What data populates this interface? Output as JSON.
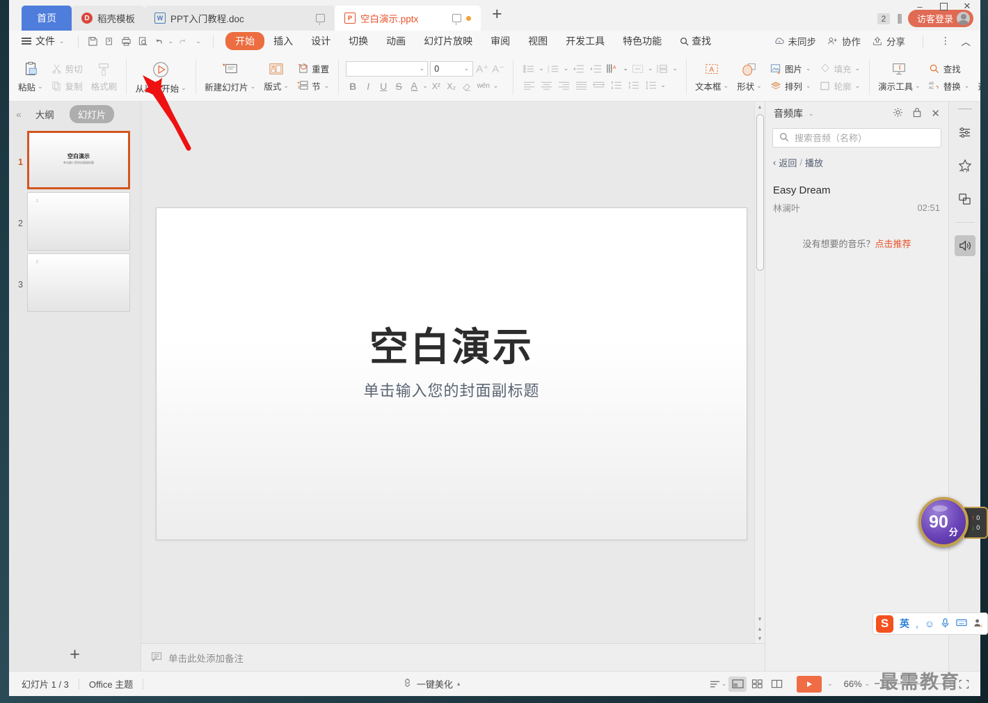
{
  "window": {
    "minimize": "–",
    "maximize": "▢",
    "close": "✕"
  },
  "tabs": {
    "home_label": "首页",
    "items": [
      {
        "name": "稻壳模板",
        "icon": "dockee-icon",
        "type": "plain"
      },
      {
        "name": "PPT入门教程.doc",
        "icon": "word-icon",
        "type": "doc"
      },
      {
        "name": "空白演示.pptx",
        "icon": "ppt-icon",
        "type": "active"
      }
    ],
    "new_tab": "+",
    "count_badge": "2",
    "login_label": "访客登录"
  },
  "menu": {
    "file_label": "文件",
    "quick_icons": [
      "save-icon",
      "print-preview-icon",
      "print-icon",
      "find-doc-icon",
      "undo-icon",
      "redo-icon",
      "customize-icon"
    ],
    "tabs": [
      "开始",
      "插入",
      "设计",
      "切换",
      "动画",
      "幻灯片放映",
      "审阅",
      "视图",
      "开发工具",
      "特色功能",
      "查找"
    ],
    "selected_tab": "开始",
    "right_items": [
      {
        "label": "未同步",
        "icon": "cloud-sync-icon"
      },
      {
        "label": "协作",
        "icon": "collaborate-icon"
      },
      {
        "label": "分享",
        "icon": "share-icon"
      }
    ],
    "more_icon": "more-vertical-icon",
    "collapse_icon": "chevron-up-icon"
  },
  "ribbon": {
    "clipboard": {
      "paste": "粘贴",
      "cut": "剪切",
      "copy": "复制",
      "format_painter": "格式刷"
    },
    "slideshow": {
      "from_current": "从当前开始"
    },
    "slides": {
      "new_slide": "新建幻灯片",
      "layout": "版式",
      "reset": "重置",
      "section": "节"
    },
    "font": {
      "family_value": "",
      "size_value": "0",
      "grow": "A⁺",
      "shrink": "A⁻",
      "bold": "B",
      "italic": "I",
      "underline": "U",
      "strike": "S",
      "font_color": "A",
      "superscript": "X²",
      "subscript": "X₂",
      "clear_format": "clear-format-icon",
      "phonetic": "wén"
    },
    "text_group": {
      "textbox": "文本框",
      "shape": "形状",
      "picture": "图片",
      "arrange": "排列",
      "fill": "填充",
      "outline": "轮廓"
    },
    "tools_group": {
      "present_tools": "演示工具",
      "find": "查找",
      "replace": "替换",
      "select": "选择"
    }
  },
  "slide_panel": {
    "collapse_icon": "double-chevron-left-icon",
    "tab_outline": "大纲",
    "tab_slides": "幻灯片",
    "selected_tab": "幻灯片",
    "slides": [
      {
        "num": "1",
        "title": "空白演示",
        "sub": "单击输入您的封面副标题",
        "selected": true
      },
      {
        "num": "2",
        "placeholder": "1",
        "selected": false
      },
      {
        "num": "3",
        "placeholder": "2",
        "selected": false
      }
    ],
    "add_slide": "+"
  },
  "canvas": {
    "title": "空白演示",
    "subtitle": "单击输入您的封面副标题"
  },
  "notes": {
    "placeholder": "单击此处添加备注",
    "icon": "notes-icon"
  },
  "task_pane": {
    "title": "音频库",
    "settings_icon": "gear-icon",
    "lock_icon": "lock-icon",
    "close_icon": "close-icon",
    "search_placeholder": "搜索音频（名称）",
    "search_value": "",
    "breadcrumb_back": "返回",
    "breadcrumb_sep": "/",
    "breadcrumb_current": "播放",
    "track_name": "Easy Dream",
    "track_artist": "林澜叶",
    "track_duration": "02:51",
    "footer_text": "没有想要的音乐？",
    "footer_link": "点击推荐"
  },
  "rail": {
    "items": [
      {
        "icon": "properties-icon",
        "selected": false
      },
      {
        "icon": "star-effects-icon",
        "selected": false
      },
      {
        "icon": "duplicate-icon",
        "selected": false
      },
      {
        "icon": "audio-icon",
        "selected": true
      }
    ]
  },
  "status_bar": {
    "slide_count": "幻灯片 1 / 3",
    "theme": "Office 主题",
    "beautify": "一键美化",
    "beautify_icon": "magic-icon",
    "view_icons": [
      "view-list-icon",
      "normal-view-icon",
      "sorter-view-icon",
      "reading-view-icon"
    ],
    "selected_view": "normal-view-icon",
    "play_icon": "play-icon",
    "zoom_level": "66%",
    "zoom_out": "−",
    "zoom_in": "+",
    "fit_icon": "fit-slide-icon"
  },
  "overlays": {
    "score_value": "90",
    "score_unit": "分",
    "score_up": "0",
    "score_down": "0",
    "ime": {
      "logo": "S",
      "mode": "英",
      "items": [
        "punctuation-icon",
        "emoji-icon",
        "mic-icon",
        "keyboard-icon",
        "user-icon"
      ]
    },
    "watermark": "最需教育",
    "annotation": "red-arrow-pointing-to-from-current-slide"
  }
}
